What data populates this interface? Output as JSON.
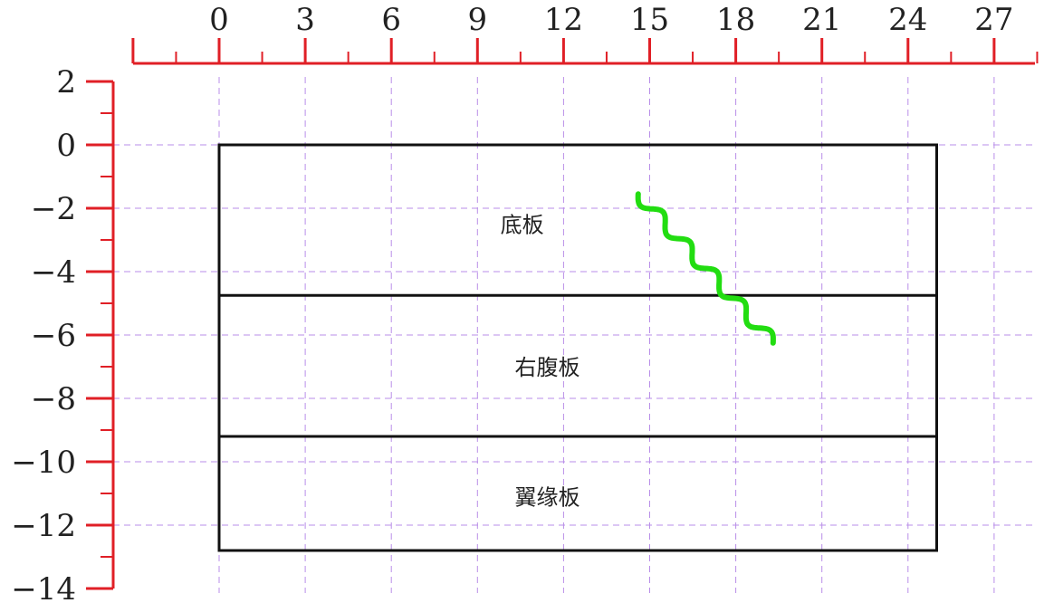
{
  "x_axis": {
    "labels": [
      "0",
      "3",
      "6",
      "9",
      "12",
      "15",
      "18",
      "21",
      "24",
      "27"
    ],
    "min": -3,
    "max": 28.5,
    "major_step": 3,
    "minor_step": 1.5,
    "color": "#e01f26"
  },
  "y_axis": {
    "labels": [
      "2",
      "0",
      "−2",
      "−4",
      "−6",
      "−8",
      "−10",
      "−12",
      "−14"
    ],
    "min": -14,
    "max": 2,
    "major_step": 2,
    "minor_step": 1,
    "color": "#e01f26"
  },
  "grid": {
    "on": true,
    "color": "#b98ee8",
    "style": "dashed"
  },
  "diagram": {
    "outline": {
      "x": [
        0,
        25
      ],
      "y": [
        0,
        -12.8
      ]
    },
    "dividers_y": [
      -4.75,
      -9.2
    ],
    "panels": [
      {
        "label": "底板",
        "x": 9.8,
        "y": -2.5
      },
      {
        "label": "右腹板",
        "x": 10.3,
        "y": -7.0
      },
      {
        "label": "翼缘板",
        "x": 10.3,
        "y": -11.1
      }
    ],
    "crack": {
      "color": "#22dd11",
      "start": {
        "x": 14.6,
        "y": -1.55
      },
      "end": {
        "x": 19.3,
        "y": -6.25
      },
      "waves": 5
    }
  }
}
